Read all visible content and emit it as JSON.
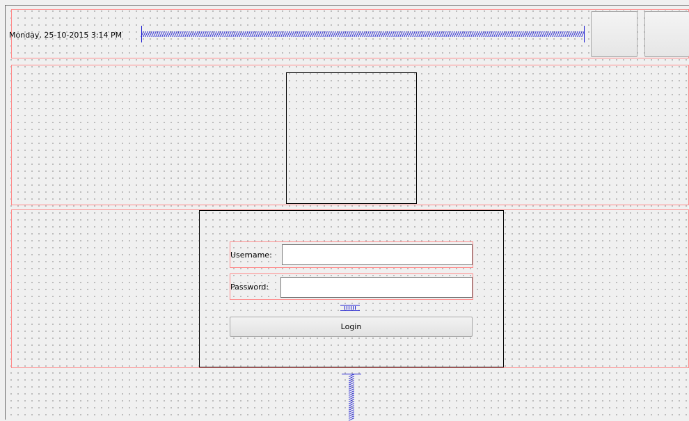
{
  "header": {
    "datetime": "Monday, 25-10-2015 3:14 PM"
  },
  "login_form": {
    "username_label": "Username:",
    "username_value": "",
    "password_label": "Password:",
    "password_value": "",
    "login_label": "Login"
  },
  "colors": {
    "layout_outline": "#ff8a8a",
    "spacer": "#1a1ad0",
    "frame_border": "#000000"
  },
  "icons": [
    "horizontal-spacer-icon",
    "vertical-spacer-icon"
  ]
}
